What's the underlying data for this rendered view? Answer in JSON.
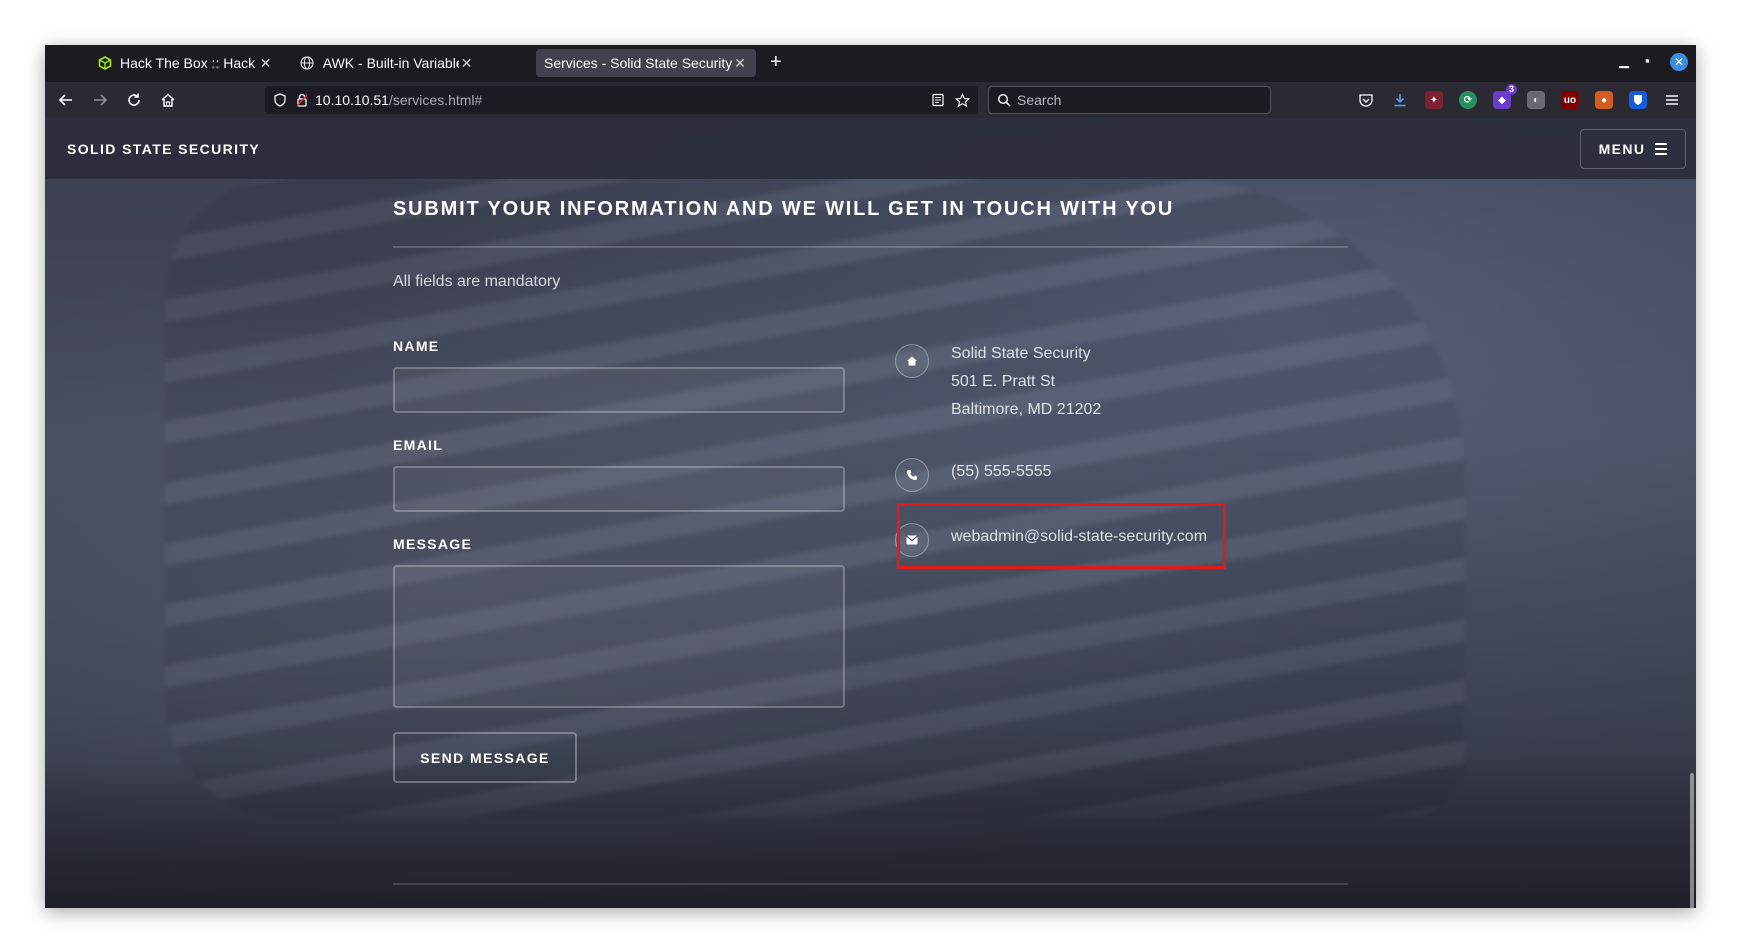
{
  "browser": {
    "tabs": [
      {
        "label": "Hack The Box :: Hack The B",
        "favicon": "htb-cube-icon",
        "active": false
      },
      {
        "label": "AWK - Built-in Variables",
        "favicon": "globe-icon",
        "active": false
      },
      {
        "label": "Services - Solid State Security",
        "favicon": null,
        "active": true
      }
    ],
    "url": {
      "host": "10.10.10.51",
      "path": "/services.html#"
    },
    "search_placeholder": "Search",
    "extension_badge": "3"
  },
  "site": {
    "brand": "SOLID STATE SECURITY",
    "menu_label": "MENU"
  },
  "contact_section": {
    "title": "SUBMIT YOUR INFORMATION AND WE WILL GET IN TOUCH WITH YOU",
    "subtitle": "All fields are mandatory",
    "form": {
      "name_label": "NAME",
      "email_label": "EMAIL",
      "message_label": "MESSAGE",
      "submit_label": "SEND MESSAGE"
    },
    "info": {
      "address_lines": [
        "Solid State Security",
        "501 E. Pratt St",
        "Baltimore, MD 21202"
      ],
      "phone": "(55) 555-5555",
      "email": "webadmin@solid-state-security.com"
    }
  },
  "colors": {
    "highlight": "#e01a1a",
    "browser_chrome": "#1c1b22",
    "site_header": "#2c2e3c"
  }
}
